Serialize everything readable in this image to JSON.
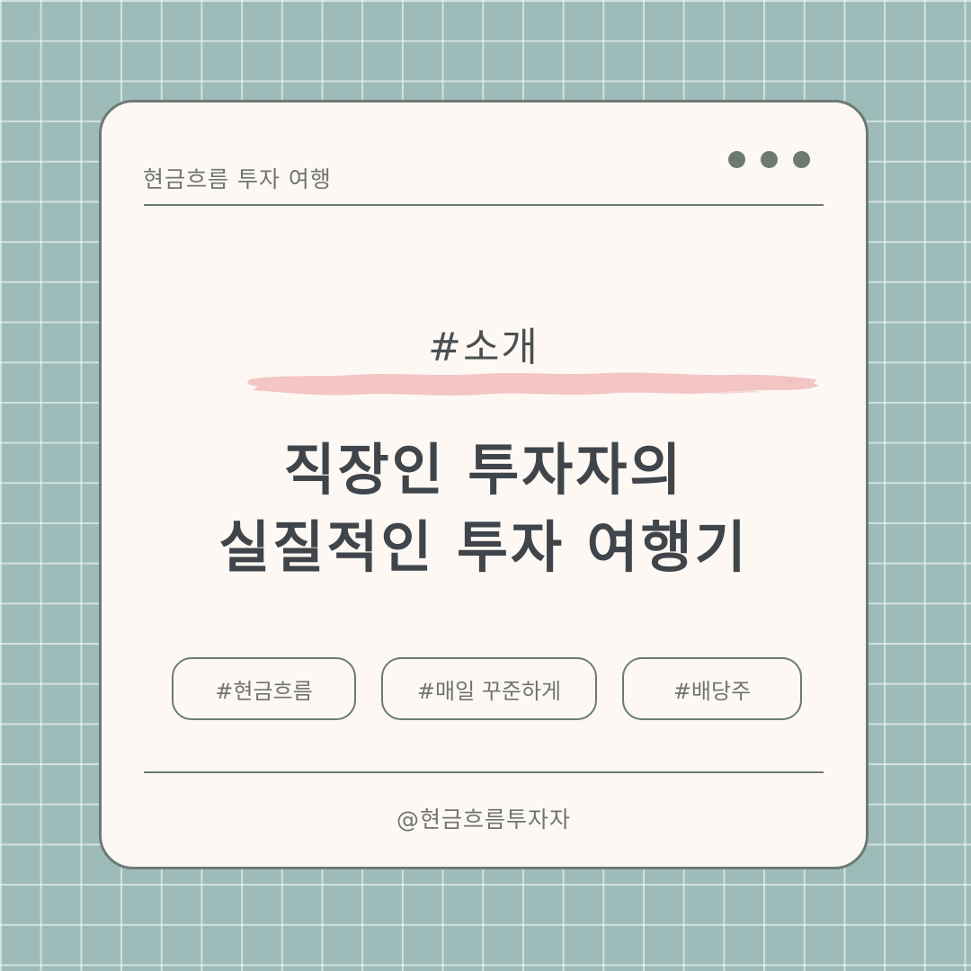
{
  "brand": {
    "title": "현금흐름 투자 여행"
  },
  "window_controls": {
    "icon": "three-dots-icon",
    "color": "#6c7a76"
  },
  "category": {
    "label": "#소개",
    "highlight_color": "#f2c2c2"
  },
  "headline": {
    "line1": "직장인 투자자의",
    "line2": "실질적인 투자 여행기"
  },
  "tags": [
    {
      "label": "#현금흐름"
    },
    {
      "label": "#매일 꾸준하게"
    },
    {
      "label": "#배당주"
    }
  ],
  "footer": {
    "handle": "@현금흐름투자자"
  },
  "colors": {
    "background": "#9dbcb9",
    "card": "#fdf8f3",
    "border": "#6c7a76",
    "headline": "#3f454a",
    "text": "#6f7472"
  }
}
